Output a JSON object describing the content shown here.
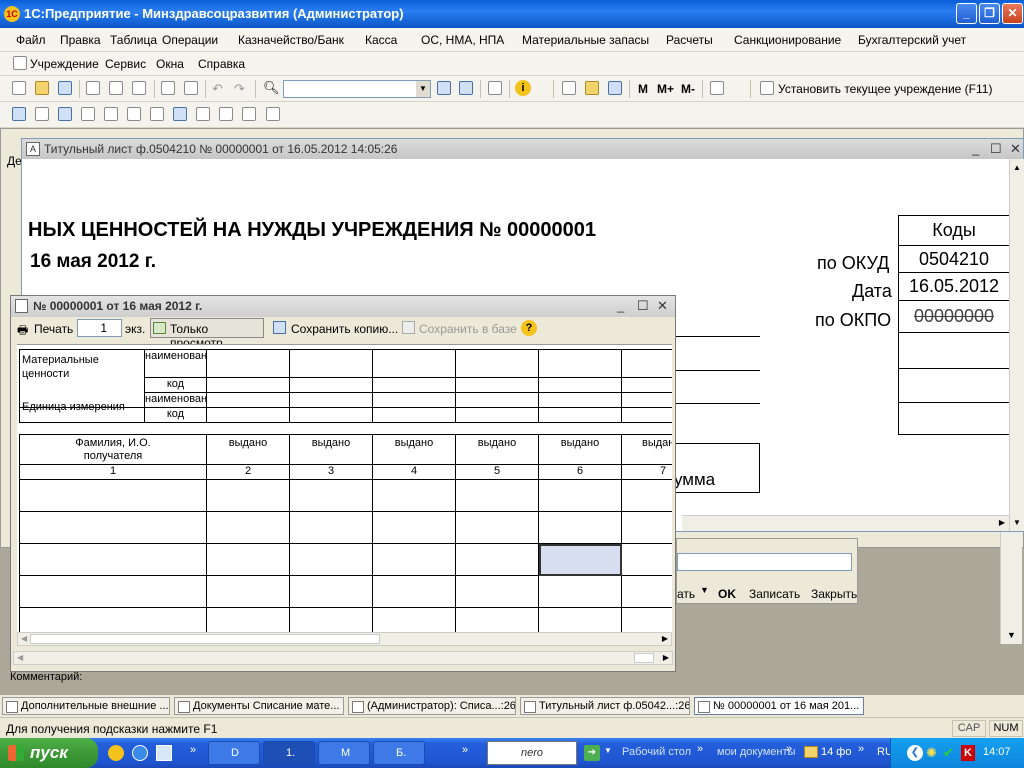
{
  "app": {
    "title": "1С:Предприятие - Минздравсоцразвития (Администратор)",
    "logo": "1C"
  },
  "menu": [
    "Файл",
    "Правка",
    "Таблица",
    "Операции",
    "Казначейство/Банк",
    "Касса",
    "ОС, НМА, НПА",
    "Материальные запасы",
    "Расчеты",
    "Санкционирование",
    "Бухгалтерский учет",
    "Учреждение",
    "Сервис",
    "Окна",
    "Справка"
  ],
  "toolbar": {
    "set_institution": "Установить текущее учреждение (F11)"
  },
  "doc_window": {
    "title": "Титульный лист ф.0504210  № 00000001  от 16.05.2012 14:05:26",
    "heading": "НЫХ ЦЕННОСТЕЙ НА НУЖДЫ УЧРЕЖДЕНИЯ № 00000001",
    "date_line": "16 мая 2012 г.",
    "codes_header": "Коды",
    "okud_label": "по ОКУД",
    "okud_value": "0504210",
    "date_label": "Дата",
    "date_value": "16.05.2012",
    "okpo_label": "по ОКПО",
    "okpo_value": "00000000",
    "summa": "умма"
  },
  "behind": {
    "left_letters": "Де",
    "buttons": [
      "ать",
      "OK",
      "Записать",
      "Закрыть"
    ]
  },
  "print_window": {
    "title": "№ 00000001 от 16 мая 2012 г.",
    "print": "Печать",
    "copies": "1",
    "copies_unit": "экз.",
    "view_only": "Только просмотр",
    "save_copy": "Сохранить копию...",
    "save_base": "Сохранить в базе",
    "rows": {
      "mat_values": "Материальные ценности",
      "name": "наименование",
      "code": "код",
      "unit": "Единица измерения",
      "unit_name": "наименован",
      "fio": "Фамилия, И.О. получателя",
      "issued": "выдано",
      "issued_cut": "выдан"
    },
    "numbers": [
      "1",
      "2",
      "3",
      "4",
      "5",
      "6",
      "7"
    ]
  },
  "comment_label": "Комментарий:",
  "window_tabs": [
    "Дополнительные внешние ...",
    "Документы Списание мате...",
    "(Администратор): Списа...:26",
    "Титульный лист ф.05042...:26",
    "№ 00000001 от 16 мая 201..."
  ],
  "status": {
    "hint": "Для получения подсказки нажмите F1",
    "cap": "CAP",
    "num": "NUM"
  },
  "taskbar": {
    "start": "пуск",
    "items": [
      "D",
      "1.",
      "М",
      "Б."
    ],
    "nero": "nero",
    "desktop": "Рабочий стол",
    "mydocs": "мои документы",
    "folder": "14 фо",
    "lang": "RU",
    "time": "14:07"
  }
}
